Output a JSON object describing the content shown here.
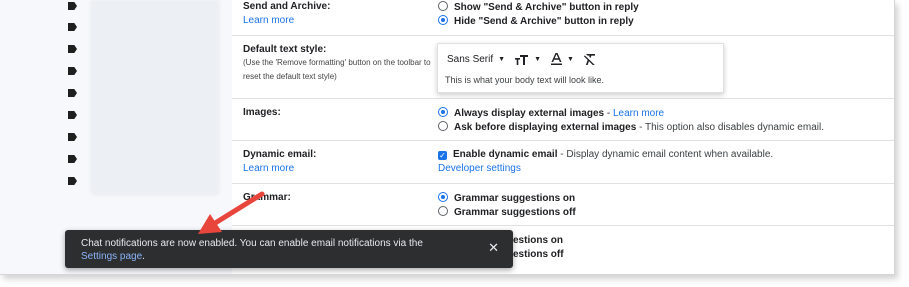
{
  "settings": {
    "send_archive": {
      "label": "Send and Archive:",
      "link": "Learn more",
      "options": [
        {
          "text": "Show \"Send & Archive\" button in reply",
          "selected": false
        },
        {
          "text": "Hide \"Send & Archive\" button in reply",
          "selected": true
        }
      ]
    },
    "default_text_style": {
      "label": "Default text style:",
      "note": "(Use the 'Remove formatting' button on the toolbar to reset the default text style)",
      "font": "Sans Serif",
      "preview": "This is what your body text will look like."
    },
    "images": {
      "label": "Images:",
      "options": [
        {
          "bold": "Always display external images",
          "sep": " - ",
          "link": "Learn more",
          "selected": true
        },
        {
          "bold": "Ask before displaying external images",
          "desc": " - This option also disables dynamic email.",
          "selected": false
        }
      ]
    },
    "dynamic_email": {
      "label": "Dynamic email:",
      "link": "Learn more",
      "checkbox_label": "Enable dynamic email",
      "checkbox_desc": " - Display dynamic email content when available.",
      "checked": true,
      "dev_link": "Developer settings"
    },
    "grammar": {
      "label": "Grammar:",
      "options": [
        {
          "text": "Grammar suggestions on",
          "selected": true
        },
        {
          "text": "Grammar suggestions off",
          "selected": false
        }
      ]
    },
    "partial_behind_toast": [
      "estions on",
      "estions off"
    ]
  },
  "toast": {
    "text": "Chat notifications are now enabled. You can enable email notifications via the",
    "link": "Settings page",
    "period": ".",
    "close": "✕"
  },
  "colors": {
    "accent": "#1a73e8",
    "toast_bg": "#2d2e30",
    "toast_link": "#8ab4f8",
    "arrow": "#e8453c"
  },
  "icons": [
    "label-tag-icon",
    "text-size-icon",
    "text-color-icon",
    "remove-formatting-icon",
    "close-icon",
    "annotation-arrow"
  ]
}
